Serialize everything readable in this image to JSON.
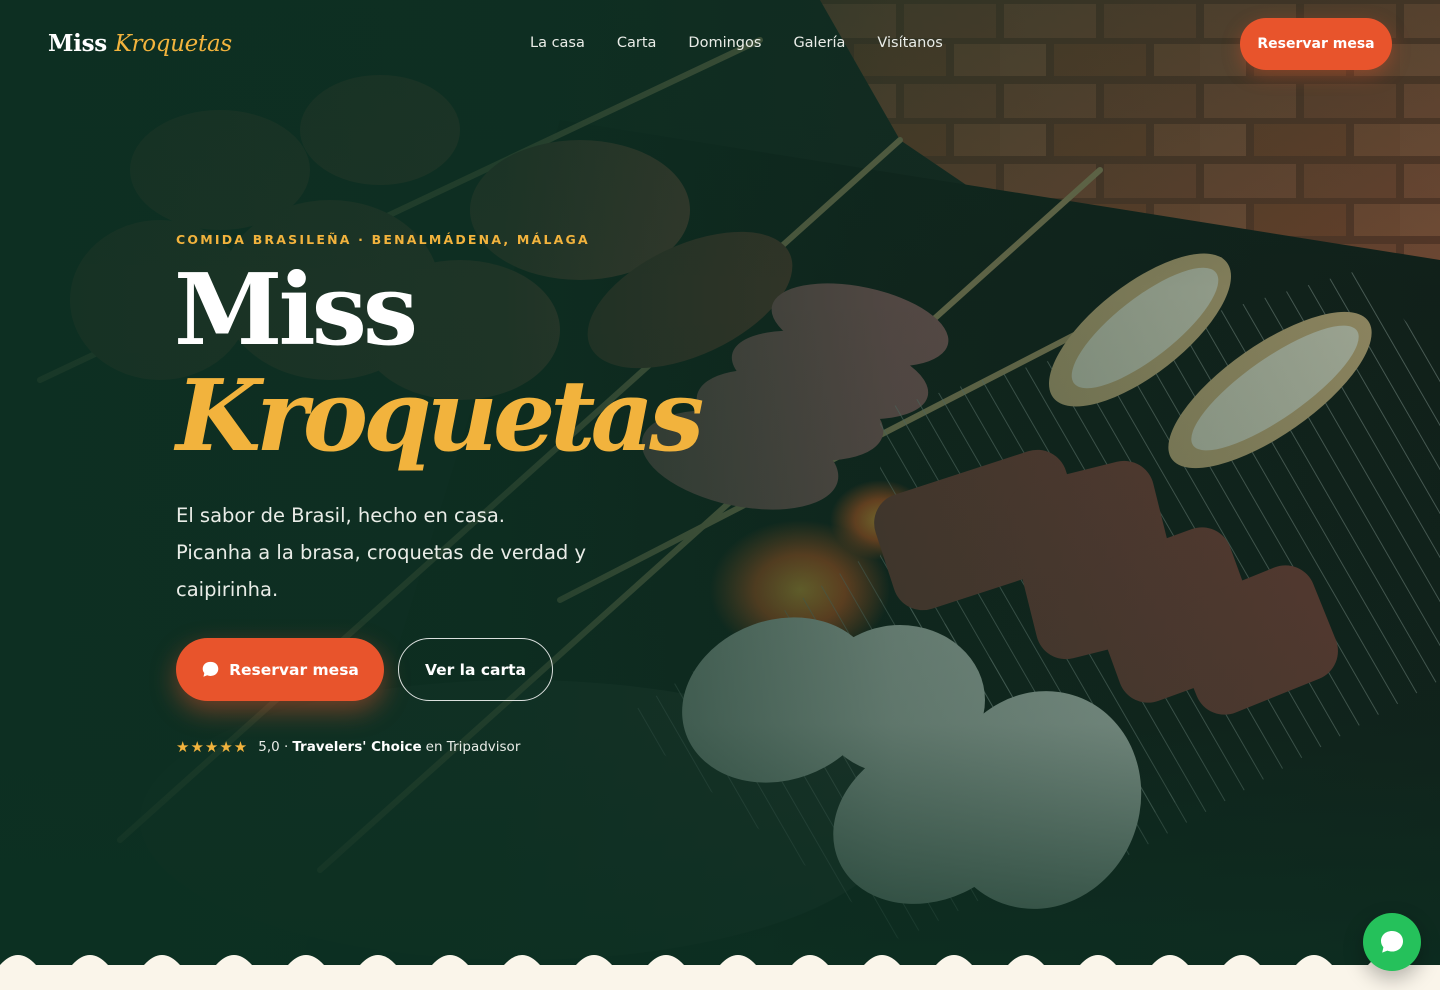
{
  "brand": {
    "name_part1": "Miss",
    "name_part2": "Kroquetas"
  },
  "nav": {
    "items": [
      "La casa",
      "Carta",
      "Domingos",
      "Galería",
      "Visítanos"
    ],
    "cta": "Reservar mesa"
  },
  "hero": {
    "eyebrow": "COMIDA BRASILEÑA · BENALMÁDENA, MÁLAGA",
    "title_line1": "Miss",
    "title_line2": "Kroquetas",
    "subtitle_line1": "El sabor de Brasil, hecho en casa.",
    "subtitle_line2": "Picanha a la brasa, croquetas de verdad y caipirinha.",
    "primary_button": "Reservar mesa",
    "secondary_button": "Ver la carta",
    "rating": {
      "stars": "★★★★★",
      "score": "5,0 ·",
      "award": "Travelers' Choice",
      "suffix": "en Tripadvisor"
    }
  },
  "icons": {
    "primary_button_icon": "chat-bubble-icon",
    "floating_button_icon": "whatsapp-chat-icon",
    "rating_icon": "star-icon"
  },
  "colors": {
    "accent": "#e8542c",
    "gold": "#f2b33d",
    "dark_green": "#0c3022",
    "cream": "#faf5ea",
    "whatsapp": "#25c15b"
  }
}
